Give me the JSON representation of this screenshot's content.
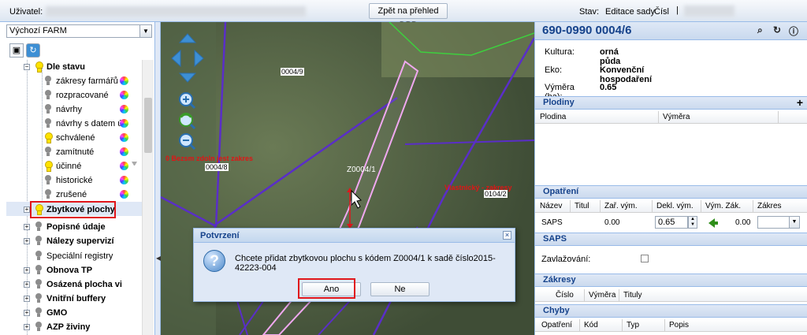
{
  "topbar": {
    "user_label": "Uživatel:",
    "back_button": "Zpět na přehled DPB",
    "stav_label": "Stav:",
    "stav_value": "Editace sady",
    "cislo_label": "Čísl"
  },
  "left": {
    "profile_select": "Výchozí FARM",
    "tree": {
      "dle_stavu": "Dle stavu",
      "items": [
        "zákresy farmářů",
        "rozpracované",
        "návrhy",
        "návrhy s datem ú",
        "schválené",
        "zamítnuté",
        "účinné",
        "historické",
        "zrušené"
      ],
      "zbytkove": "Zbytkové plochy",
      "popisne": "Popisné údaje",
      "nalezy": "Nálezy supervizí",
      "specialni": "Speciální registry",
      "obnova": "Obnova TP",
      "osazena": "Osázená plocha vi",
      "buffery": "Vnitřní buffery",
      "gmo": "GMO",
      "azp": "AZP živiny"
    }
  },
  "map": {
    "labels": {
      "l0004_9": "0004/9",
      "l0004_8": "0004/8",
      "l0104_2": "0104/2",
      "z0004_1": "Z0004/1"
    },
    "red_text_left": "0 Bezsm zdoln jest zakres",
    "red_text_right": "Vlastnický - zakresy"
  },
  "dialog": {
    "title": "Potvrzení",
    "message": "Chcete přidat zbytkovou plochu s kódem Z0004/1 k sadě číslo2015-42223-004",
    "yes": "Ano",
    "no": "Ne"
  },
  "right": {
    "code": "690-0990 0004/6",
    "kultura_label": "Kultura:",
    "kultura_value": "orná půda",
    "eko_label": "Eko:",
    "eko_value": "Konvenční hospodaření",
    "vymera_label": "Výměra (ha):",
    "vymera_value": "0.65",
    "plodiny": {
      "title": "Plodiny",
      "cols": [
        "Plodina",
        "Výměra"
      ]
    },
    "opatreni": {
      "title": "Opatření",
      "cols": [
        "Název",
        "Titul",
        "Zař. vým.",
        "Dekl. vým.",
        "Vým. Zák.",
        "Zákres"
      ],
      "row": {
        "nazev": "SAPS",
        "zar": "0.00",
        "dekl": "0.65",
        "zak": "0.00"
      }
    },
    "saps": {
      "title": "SAPS",
      "zavlazovani": "Zavlažování:"
    },
    "zakresy": {
      "title": "Zákresy",
      "cols": [
        "Číslo",
        "Výměra",
        "Tituly"
      ]
    },
    "chyby": {
      "title": "Chyby",
      "cols": [
        "Opatření",
        "Kód",
        "Typ",
        "Popis"
      ]
    }
  },
  "colors": {
    "accent": "#15428b",
    "highlight": "#e0161b",
    "parcel_line": "#5a2ec8",
    "selected_parcel": "#f0a8f0"
  }
}
